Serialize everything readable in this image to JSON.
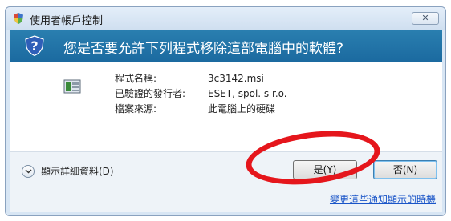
{
  "window": {
    "title": "使用者帳戶控制",
    "close_label": "✕"
  },
  "banner": {
    "question": "您是否要允許下列程式移除這部電腦中的軟體?"
  },
  "program_info": {
    "rows": [
      {
        "label": "程式名稱:",
        "value": "3c3142.msi"
      },
      {
        "label": "已驗證的發行者:",
        "value": "ESET, spol. s r.o."
      },
      {
        "label": "檔案來源:",
        "value": "此電腦上的硬碟"
      }
    ]
  },
  "footer": {
    "details_label": "顯示詳細資料(D)",
    "yes_label": "是(Y)",
    "no_label": "否(N)",
    "notification_link": "變更這些通知顯示的時機"
  },
  "colors": {
    "banner": "#1b6aa0",
    "annotation_circle": "#e5161c",
    "link": "#1a55c8"
  }
}
